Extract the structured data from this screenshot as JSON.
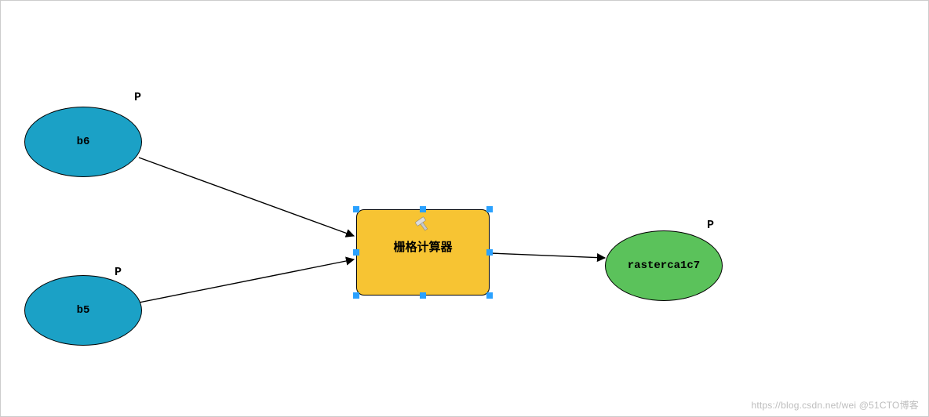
{
  "nodes": {
    "input1": {
      "label": "b6",
      "badge": "P"
    },
    "input2": {
      "label": "b5",
      "badge": "P"
    },
    "tool": {
      "label": "栅格计算器",
      "icon": "hammer-icon"
    },
    "output": {
      "label": "rasterca1c7",
      "badge": "P"
    }
  },
  "watermark": "https://blog.csdn.net/wei @51CTO博客",
  "colors": {
    "input": "#1ba1c6",
    "tool": "#f7c433",
    "output": "#5bc25b",
    "selection": "#2aa1ff"
  },
  "chart_data": {
    "type": "diagram",
    "nodes": [
      {
        "id": "b6",
        "kind": "input",
        "label": "b6",
        "badge": "P"
      },
      {
        "id": "b5",
        "kind": "input",
        "label": "b5",
        "badge": "P"
      },
      {
        "id": "rastercalc",
        "kind": "tool",
        "label": "栅格计算器",
        "selected": true
      },
      {
        "id": "rasterca1c7",
        "kind": "output",
        "label": "rasterca1c7",
        "badge": "P"
      }
    ],
    "edges": [
      {
        "from": "b6",
        "to": "rastercalc"
      },
      {
        "from": "b5",
        "to": "rastercalc"
      },
      {
        "from": "rastercalc",
        "to": "rasterca1c7"
      }
    ]
  }
}
